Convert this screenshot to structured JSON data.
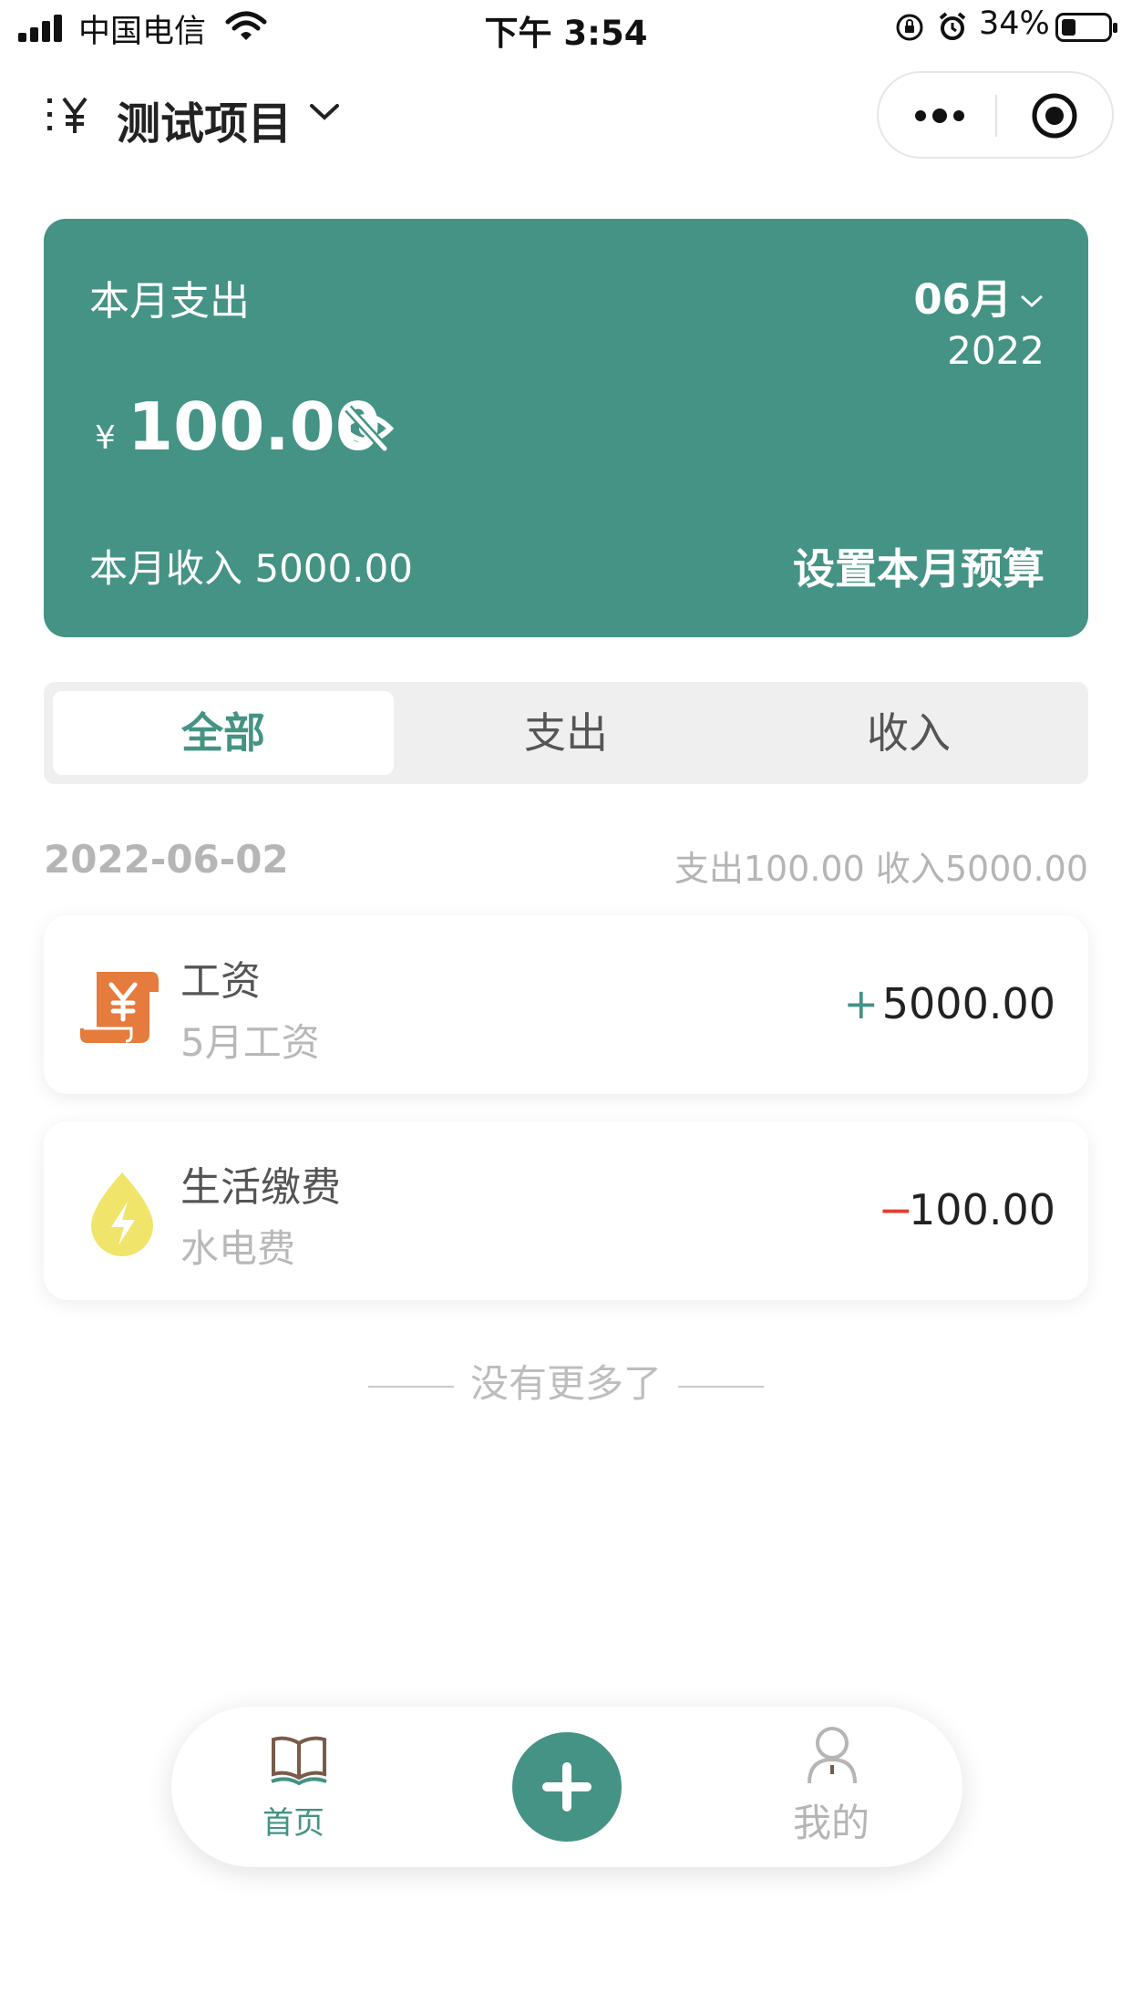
{
  "status_bar": {
    "carrier": "中国电信",
    "time": "下午 3:54",
    "battery_percent": "34%",
    "battery_level": 0.34,
    "icons": [
      "signal-icon",
      "wifi-icon",
      "rotation-lock-icon",
      "alarm-icon",
      "battery-icon"
    ]
  },
  "nav": {
    "title": "测试项目",
    "icons": [
      "ledger-menu-icon",
      "chevron-down-icon",
      "more-dots-icon",
      "target-circle-icon"
    ]
  },
  "summary": {
    "label": "本月支出",
    "month": "06月",
    "year": "2022",
    "currency": "¥",
    "amount": "100.00",
    "income_label": "本月收入 5000.00",
    "budget_label": "设置本月预算",
    "colors": {
      "card": "#449384"
    }
  },
  "tabs": [
    {
      "label": "全部",
      "active": true
    },
    {
      "label": "支出",
      "active": false
    },
    {
      "label": "收入",
      "active": false
    }
  ],
  "day": {
    "date": "2022-06-02",
    "summary": "支出100.00  收入5000.00"
  },
  "records": [
    {
      "title": "工资",
      "note": "5月工资",
      "sign": "+",
      "amount": "5000.00",
      "icon": "salary-scroll-icon",
      "icon_color": "#e57b3d"
    },
    {
      "title": "生活缴费",
      "note": "水电费",
      "sign": "−",
      "amount": "100.00",
      "icon": "utility-drop-icon",
      "icon_color": "#f1e46a"
    }
  ],
  "footer_note": "没有更多了",
  "tabbar": {
    "home_label": "首页",
    "me_label": "我的",
    "icons": [
      "book-icon",
      "plus-icon",
      "user-icon"
    ],
    "accent": "#449384"
  }
}
